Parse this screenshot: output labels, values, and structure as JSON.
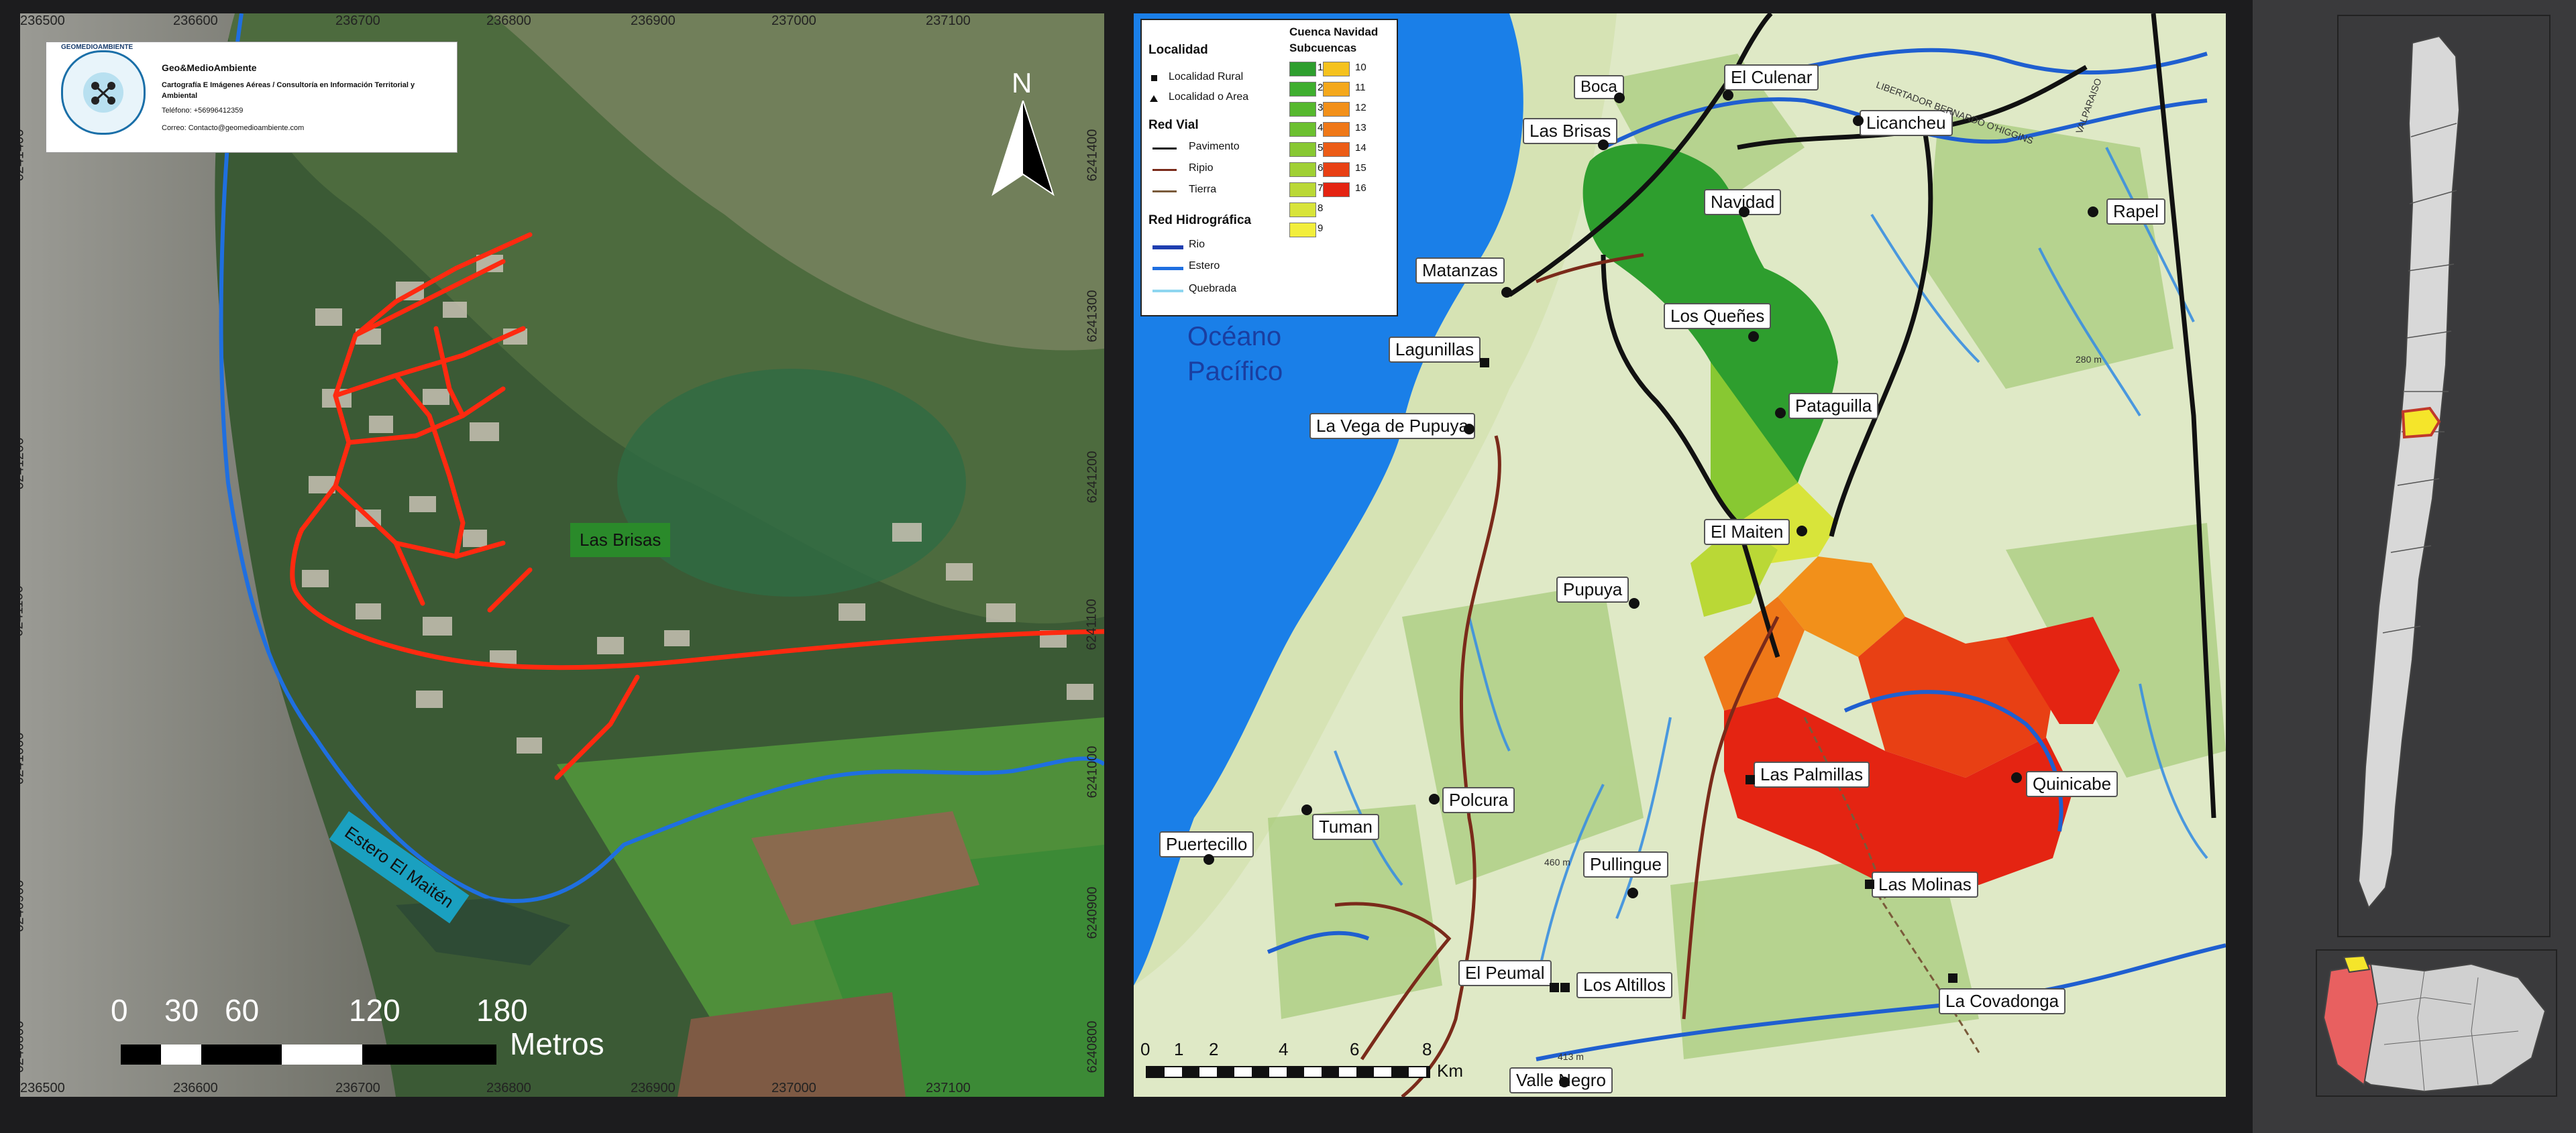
{
  "panel_left": {
    "logo": {
      "brand": "GEOMEDIOAMBIENTE",
      "name": "Geo&MedioAmbiente",
      "tagline": "Cartografía E Imágenes Aéreas / Consultoría en Información Territorial y Ambiental",
      "phone": "Teléfono: +56996412359",
      "email": "Correo: Contacto@geomedioambiente.com"
    },
    "north": "N",
    "labels": {
      "village": "Las Brisas",
      "stream": "Estero El Maitén"
    },
    "scale": {
      "ticks": [
        "0",
        "30",
        "60",
        "120",
        "180"
      ],
      "unit": "Metros"
    },
    "top_ticks": [
      "236500",
      "236600",
      "236700",
      "236800",
      "236900",
      "237000",
      "237100"
    ],
    "bottom_ticks": [
      "236500",
      "236600",
      "236700",
      "236800",
      "236900",
      "237000",
      "237100"
    ],
    "right_ticks": [
      "6241400",
      "6241300",
      "6241200",
      "6241100",
      "6241000",
      "6240900",
      "6240800"
    ],
    "left_ticks": [
      "6241400",
      "6241200",
      "6241100",
      "6241000",
      "6240900",
      "6240800"
    ]
  },
  "panel_middle": {
    "legend": {
      "localidad_title": "Localidad",
      "localidad": [
        "Localidad Rural",
        "Localidad o Area"
      ],
      "red_vial_title": "Red Vial",
      "red_vial": [
        "Pavimento",
        "Ripio",
        "Tierra"
      ],
      "hidro_title": "Red Hidrográfica",
      "hidro": [
        "Rio",
        "Estero",
        "Quebrada"
      ],
      "cuenca_title": "Cuenca Navidad",
      "sub_title": "Subcuencas",
      "sub_col1": [
        "1",
        "2",
        "3",
        "4",
        "5",
        "6",
        "7",
        "8",
        "9"
      ],
      "sub_col2": [
        "10",
        "11",
        "12",
        "13",
        "14",
        "15",
        "16"
      ],
      "colors_col1": [
        "#2e9e2e",
        "#3fae2f",
        "#56b82e",
        "#6cc030",
        "#88c832",
        "#a0d034",
        "#bad836",
        "#d8e43a",
        "#f2ee3c"
      ],
      "colors_col2": [
        "#f5c21e",
        "#f4a81c",
        "#f2901a",
        "#ef7818",
        "#ec5c16",
        "#e84014",
        "#e42412"
      ]
    },
    "ocean": [
      "Océano",
      "Pacífico"
    ],
    "places": [
      "Boca",
      "El Culenar",
      "Licancheu",
      "Las Brisas",
      "Navidad",
      "Rapel",
      "Matanzas",
      "Los Queñes",
      "Lagunillas",
      "Pataguilla",
      "La Vega de Pupuya",
      "El Maiten",
      "Pupuya",
      "Las Palmillas",
      "Quinicabe",
      "Polcura",
      "Tuman",
      "Puertecillo",
      "Pullingue",
      "Las Molinas",
      "El Peumal",
      "Los Altillos",
      "La Covadonga",
      "Valle Negro"
    ],
    "road_names": [
      "LIBERTADOR BERNARDO O'HIGGINS",
      "VALPARAISO"
    ],
    "scale": {
      "ticks": [
        "0",
        "1",
        "2",
        "4",
        "6",
        "8"
      ],
      "unit": "Km"
    },
    "elevation": [
      "460 m",
      "413 m",
      "280 m"
    ]
  },
  "colors": {
    "road_red": "#ff2a10",
    "stream_blue": "#1f6fe0",
    "ocean": "#1a7fe8",
    "label_green": "#2a8a2a",
    "label_cyan": "#1aa0c0"
  }
}
